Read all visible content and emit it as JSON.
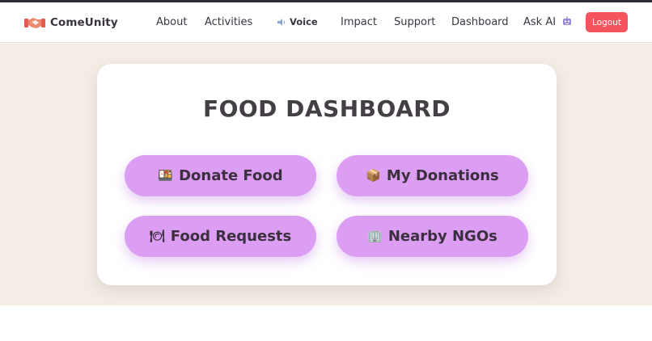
{
  "brand": {
    "name": "ComeUnity",
    "icon": "handshake-icon",
    "icon_color": "#e35c4f"
  },
  "nav": {
    "about": "About",
    "activities": "Activities",
    "voice": {
      "label": "Voice",
      "icon": "speaker-icon"
    },
    "impact": "Impact",
    "support": "Support",
    "dashboard": "Dashboard",
    "ask_ai": {
      "label": "Ask AI",
      "icon": "robot-icon"
    },
    "logout": "Logout"
  },
  "dashboard": {
    "title": "FOOD DASHBOARD",
    "buttons": [
      {
        "label": "Donate Food",
        "emoji": "🍱",
        "icon": "bento-box-icon"
      },
      {
        "label": "My Donations",
        "emoji": "📦",
        "icon": "package-icon"
      },
      {
        "label": "Food Requests",
        "emoji": "🍽",
        "icon": "plate-cutlery-icon"
      },
      {
        "label": "Nearby NGOs",
        "emoji": "🏢",
        "icon": "office-building-icon"
      }
    ]
  },
  "colors": {
    "accent": "#dc9ef2",
    "logout": "#f4555c",
    "hero_bg": "#f4ede6",
    "text_dark": "#433f45"
  }
}
